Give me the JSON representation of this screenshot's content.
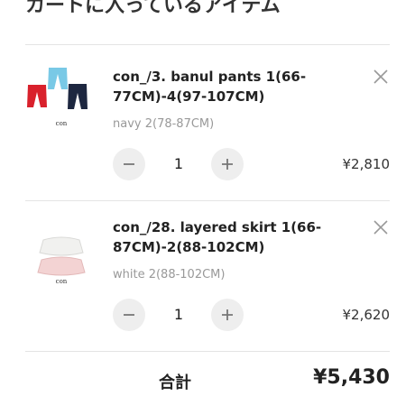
{
  "cart": {
    "heading": "カートに入っているアイテム",
    "items": [
      {
        "title": "con_/3. banul pants 1(66-77CM)-4(97-107CM)",
        "variant": "navy 2(78-87CM)",
        "quantity": "1",
        "price": "¥2,810",
        "thumbnail_caption": "con",
        "colors": [
          "#79c9e6",
          "#d9212c",
          "#1d2740"
        ]
      },
      {
        "title": "con_/28. layered skirt 1(66-87CM)-2(88-102CM)",
        "variant": "white 2(88-102CM)",
        "quantity": "1",
        "price": "¥2,620",
        "thumbnail_caption": "con",
        "colors": [
          "#f1f1ef",
          "#f3d3d3"
        ]
      }
    ],
    "total_label": "合計",
    "total_value": "¥5,430"
  },
  "icons": {
    "remove": "close-icon",
    "decrease": "minus-icon",
    "increase": "plus-icon"
  }
}
